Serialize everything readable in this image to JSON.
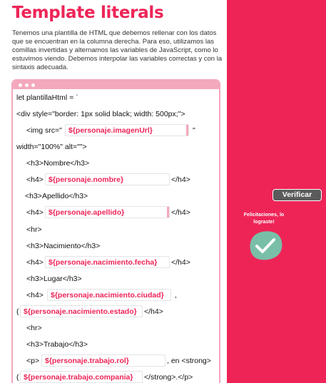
{
  "page": {
    "title": "Template literals",
    "description": "Tenemos una plantilla de HTML que debemos rellenar con los datos que se encuentran en la columna derecha. Para eso, utilizamos las comillas invertidas y alternamos las variables de JavaScript, como lo estuvimos viendo. Debemos interpolar las variables correctas y con la sintaxis adecuada."
  },
  "code": {
    "l1": "let plantillaHtml = `",
    "l2": "<div style=\"border: 1px solid black; width: 500px;\">",
    "l3a": "<img src=\"",
    "l3b": "\"",
    "l4": "width=\"100%\" alt=\"\">",
    "l5": "<h3>Nombre</h3>",
    "l6a": "<h4>",
    "l6b": "</h4>",
    "l7": "<h3>Apellido</h3>",
    "l8a": "<h4>",
    "l8b": "</h4>",
    "l9": "<hr>",
    "l10": "<h3>Nacimiento</h3>",
    "l11a": "<h4>",
    "l11b": "</h4>",
    "l12": "<h3>Lugar</h3>",
    "l13a": "<h4>",
    "l13b": ",",
    "l14b": "</h4>",
    "l15": "<hr>",
    "l16": "<h3>Trabajo</h3>",
    "l17a": "<p>",
    "l17b": ", en <strong>",
    "l18b": "</strong>.</p>"
  },
  "slots": {
    "imagen": "${personaje.imagenUrl}",
    "nombre": "${personaje.nombre}",
    "apellido": "${personaje.apellido}",
    "fecha": "${personaje.nacimiento.fecha}",
    "ciudad": "${personaje.nacimiento.ciudad}",
    "estado": "${personaje.nacimiento.estado}",
    "rol": "${personaje.trabajo.rol}",
    "compania": "${personaje.trabajo.compania}"
  },
  "actions": {
    "verify_label": "Verificar"
  },
  "feedback": {
    "message": "Felicitaciones, lo lograste!",
    "icon": "checkmark-icon"
  },
  "colors": {
    "accent": "#ee2457",
    "accent_light": "#f3a8bb",
    "button": "#5b5b5b",
    "success_blob": "#79bfa8"
  }
}
